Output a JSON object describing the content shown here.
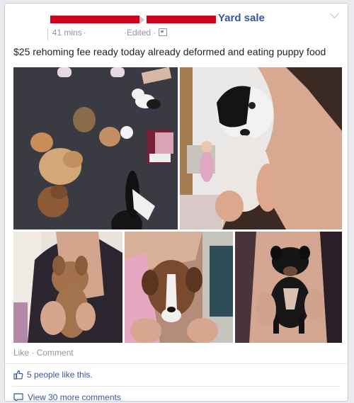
{
  "post": {
    "group_name": "Yard sale",
    "time": "41 mins",
    "edited": "Edited",
    "text": "$25 rehoming fee ready today already deformed and eating puppy food",
    "privacy_icon": "group-audience-icon"
  },
  "photos": [
    {
      "name": "puppies-group-photo"
    },
    {
      "name": "black-white-puppy-held-photo"
    },
    {
      "name": "brown-puppy-held-photo"
    },
    {
      "name": "brown-white-puppy-photo"
    },
    {
      "name": "black-puppy-held-photo"
    }
  ],
  "actions": {
    "like": "Like",
    "separator": " · ",
    "comment": "Comment"
  },
  "reactions": {
    "likes_text": "5 people like this.",
    "icon": "thumbs-up-icon"
  },
  "comments": {
    "view_more": "View 30 more comments",
    "icon": "comment-bubble-icon"
  },
  "colors": {
    "link": "#365899",
    "meta": "#90949c",
    "redaction": "#d0021b"
  }
}
